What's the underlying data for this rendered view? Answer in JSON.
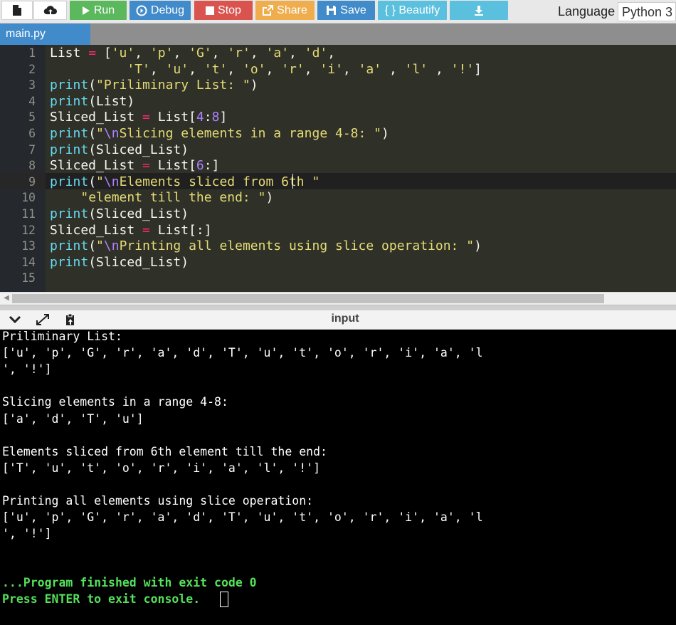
{
  "toolbar": {
    "run_label": "Run",
    "debug_label": "Debug",
    "stop_label": "Stop",
    "share_label": "Share",
    "save_label": "Save",
    "beautify_label": "{ } Beautify",
    "language_label": "Language",
    "language_value": "Python 3",
    "icons": [
      "file-icon",
      "upload-icon",
      "play-icon",
      "debug-icon",
      "stop-icon",
      "share-icon",
      "save-icon",
      "download-icon"
    ],
    "colors": {
      "run": "#5cb85c",
      "debug": "#428bca",
      "stop": "#d9534f",
      "share": "#f0ad4e",
      "save": "#428bca",
      "beautify": "#5bc0de",
      "download": "#5bc0de"
    }
  },
  "tab": {
    "label": "main.py"
  },
  "editor": {
    "line_numbers": [
      "1",
      "2",
      "3",
      "4",
      "5",
      "6",
      "7",
      "8",
      "9",
      "10",
      "11",
      "12",
      "13",
      "14",
      "15"
    ],
    "lines": [
      "List = ['u', 'p', 'G', 'r', 'a', 'd',",
      "          'T', 'u', 't', 'o', 'r', 'i', 'a' , 'l' , '!']",
      "print(\"Priliminary List: \")",
      "print(List)",
      "Sliced_List = List[4:8]",
      "print(\"\\nSlicing elements in a range 4-8: \")",
      "print(Sliced_List)",
      "Sliced_List = List[6:]",
      "print(\"\\nElements sliced from 6th \"",
      "    \"element till the end: \")",
      "print(Sliced_List)",
      "Sliced_List = List[:]",
      "print(\"\\nPrinting all elements using slice operation: \")",
      "print(Sliced_List)",
      ""
    ]
  },
  "io": {
    "title": "input",
    "icons": [
      "chevron-down-icon",
      "expand-icon",
      "clipboard-icon"
    ]
  },
  "console": {
    "lines": [
      "Priliminary List:",
      "['u', 'p', 'G', 'r', 'a', 'd', 'T', 'u', 't', 'o', 'r', 'i', 'a', 'l",
      "', '!']",
      "",
      "Slicing elements in a range 4-8:",
      "['a', 'd', 'T', 'u']",
      "",
      "Elements sliced from 6th element till the end:",
      "['T', 'u', 't', 'o', 'r', 'i', 'a', 'l', '!']",
      "",
      "Printing all elements using slice operation:",
      "['u', 'p', 'G', 'r', 'a', 'd', 'T', 'u', 't', 'o', 'r', 'i', 'a', 'l",
      "', '!']"
    ],
    "finished": "...Program finished with exit code 0",
    "press_enter": "Press ENTER to exit console."
  }
}
